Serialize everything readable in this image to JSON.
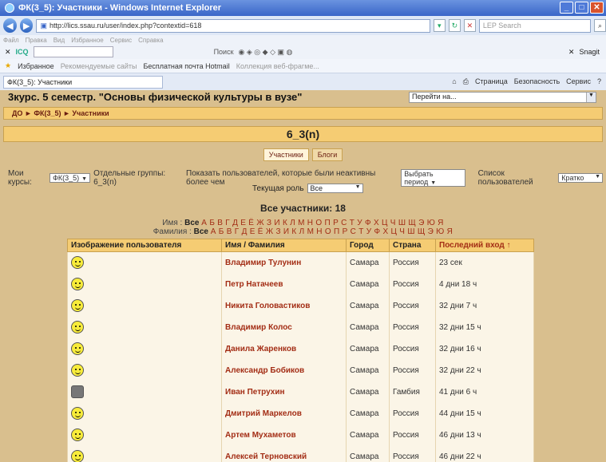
{
  "window": {
    "title": "ФК(3_5): Участники - Windows Internet Explorer",
    "url": "http://lics.ssau.ru/user/index.php?contextid=618",
    "search_placeholder": "LEP Search",
    "menu": [
      "Файл",
      "Правка",
      "Вид",
      "Избранное",
      "Сервис",
      "Справка"
    ]
  },
  "toolbar": {
    "icq": "ICQ",
    "search": "Поиск",
    "snagit": "Snagit"
  },
  "favorites": {
    "label": "Избранное",
    "links": [
      "Рекомендуемые сайты",
      "Бесплатная почта Hotmail",
      "Коллекция веб-фрагме..."
    ]
  },
  "tab": {
    "title": "ФК(3_5): Участники",
    "tools": [
      "Страница",
      "Безопасность",
      "Сервис"
    ]
  },
  "page": {
    "course_title": "3курс. 5 семестр. \"Основы физической культуры в вузе\"",
    "jump_menu": "Перейти на...",
    "breadcrumb": "ДО ► ФК(3_5) ► Участники",
    "group_title": "6_3(n)",
    "tabs": [
      "Участники",
      "Блоги"
    ]
  },
  "filters": {
    "my_courses_label": "Мои курсы:",
    "my_courses_value": "ФК(3_5)",
    "groups_label": "Отдельные группы: 6_3(n)",
    "inactive_label": "Показать пользователей, которые были неактивны более чем",
    "inactive_value": "Выбрать период",
    "list_label": "Список пользователей",
    "list_value": "Кратко",
    "role_label": "Текущая роль",
    "role_value": "Все"
  },
  "summary": {
    "total": "Все участники: 18",
    "firstname_label": "Имя :",
    "lastname_label": "Фамилия :",
    "all": "Все",
    "letters": "А Б В Г Д Е Ё Ж З И К Л М Н О П Р С Т У Ф Х Ц Ч Ш Щ Э Ю Я"
  },
  "table": {
    "headers": [
      "Изображение пользователя",
      "Имя / Фамилия",
      "Город",
      "Страна",
      "Последний вход ↑"
    ],
    "rows": [
      {
        "name": "Владимир Тулунин",
        "city": "Самара",
        "country": "Россия",
        "last": "23 сек",
        "avatar": "smiley"
      },
      {
        "name": "Петр Натачеев",
        "city": "Самара",
        "country": "Россия",
        "last": "4 дни 18 ч",
        "avatar": "smiley"
      },
      {
        "name": "Никита Головастиков",
        "city": "Самара",
        "country": "Россия",
        "last": "32 дни 7 ч",
        "avatar": "smiley"
      },
      {
        "name": "Владимир Колос",
        "city": "Самара",
        "country": "Россия",
        "last": "32 дни 15 ч",
        "avatar": "smiley"
      },
      {
        "name": "Данила Жаренков",
        "city": "Самара",
        "country": "Россия",
        "last": "32 дни 16 ч",
        "avatar": "smiley"
      },
      {
        "name": "Александр Бобиков",
        "city": "Самара",
        "country": "Россия",
        "last": "32 дни 22 ч",
        "avatar": "smiley"
      },
      {
        "name": "Иван Петрухин",
        "city": "Самара",
        "country": "Гамбия",
        "last": "41 дни 6 ч",
        "avatar": "photo"
      },
      {
        "name": "Дмитрий Маркелов",
        "city": "Самара",
        "country": "Россия",
        "last": "44 дни 15 ч",
        "avatar": "smiley"
      },
      {
        "name": "Артем Мухаметов",
        "city": "Самара",
        "country": "Россия",
        "last": "46 дни 13 ч",
        "avatar": "smiley"
      },
      {
        "name": "Алексей Терновский",
        "city": "Самара",
        "country": "Россия",
        "last": "46 дни 22 ч",
        "avatar": "smiley"
      }
    ]
  }
}
